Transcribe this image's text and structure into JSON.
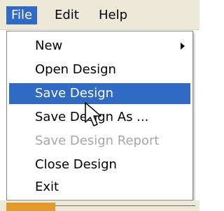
{
  "menubar": {
    "items": [
      {
        "label": "File",
        "active": true
      },
      {
        "label": "Edit",
        "active": false
      },
      {
        "label": "Help",
        "active": false
      }
    ]
  },
  "file_menu": {
    "items": [
      {
        "label": "New",
        "has_submenu": true,
        "state": "normal"
      },
      {
        "label": "Open Design",
        "state": "normal"
      },
      {
        "label": "Save Design",
        "state": "highlighted"
      },
      {
        "label": "Save Design As ...",
        "state": "normal"
      },
      {
        "label": "Save Design Report",
        "state": "disabled"
      },
      {
        "label": "Close Design",
        "state": "normal"
      },
      {
        "label": "Exit",
        "state": "normal"
      }
    ]
  },
  "colors": {
    "highlight": "#316ac5",
    "disabled_text": "#a7a6aa",
    "menubar_bg": "#ece9d8"
  },
  "icons": {
    "submenu": "chevron-right-icon",
    "pointer": "mouse-pointer-icon"
  }
}
